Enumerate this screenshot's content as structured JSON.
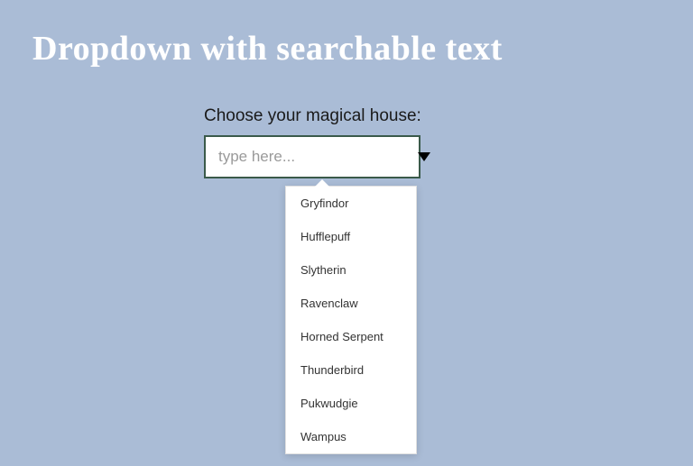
{
  "heading": "Dropdown with searchable text",
  "form": {
    "label": "Choose your magical house:",
    "placeholder": "type here..."
  },
  "options": [
    {
      "label": "Gryfindor"
    },
    {
      "label": "Hufflepuff"
    },
    {
      "label": "Slytherin"
    },
    {
      "label": "Ravenclaw"
    },
    {
      "label": "Horned Serpent"
    },
    {
      "label": "Thunderbird"
    },
    {
      "label": "Pukwudgie"
    },
    {
      "label": "Wampus"
    }
  ]
}
